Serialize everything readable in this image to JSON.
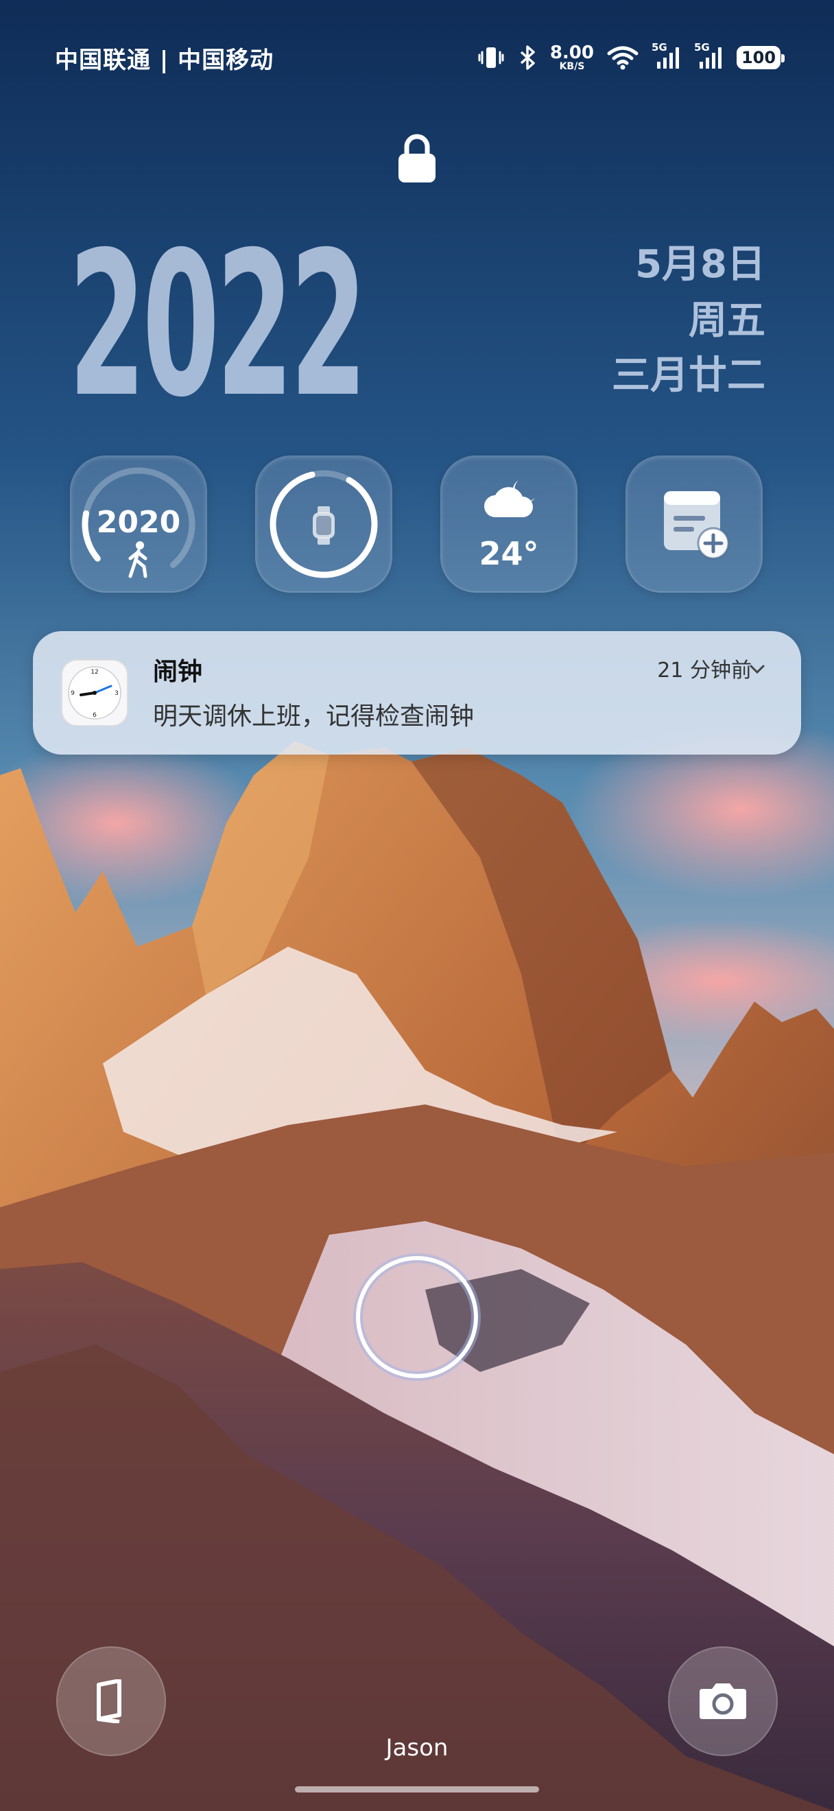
{
  "status_bar": {
    "carrier": "中国联通 | 中国移动",
    "net_speed_value": "8.00",
    "net_speed_unit": "KB/S",
    "sim1_label": "5G",
    "sim2_label": "5G",
    "battery": "100"
  },
  "lock": {
    "icon": "lock-icon"
  },
  "clock": {
    "year": "2022",
    "date": "5月8日",
    "weekday": "周五",
    "lunar": "三月廿二"
  },
  "widgets": {
    "steps": {
      "value": "2020",
      "icon": "walking-icon",
      "progress": 0.72
    },
    "watch": {
      "icon": "smartwatch-icon",
      "progress": 0.88
    },
    "weather": {
      "temp": "24°",
      "icon": "cloud-moon-icon"
    },
    "notes": {
      "icon": "add-note-icon"
    }
  },
  "notification": {
    "app": "闹钟",
    "time": "21 分钟前",
    "body": "明天调休上班，记得检查闹钟",
    "icon": "clock-app-icon"
  },
  "bottom": {
    "left_icon": "card-icon",
    "right_icon": "camera-icon",
    "user": "Jason"
  }
}
